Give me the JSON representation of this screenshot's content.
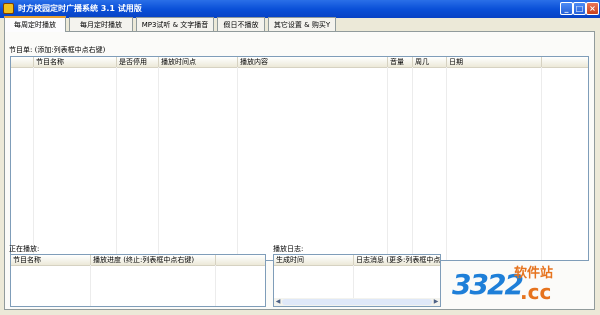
{
  "window": {
    "title": "时方校园定时广播系统 3.1 试用版",
    "buttons": {
      "minimize": "_",
      "maximize": "□",
      "close": "×"
    }
  },
  "tabs": [
    {
      "label": "每周定时播放",
      "active": true
    },
    {
      "label": "每月定时播放",
      "active": false
    },
    {
      "label": "MP3试听 & 文字播音",
      "active": false
    },
    {
      "label": "假日不播放",
      "active": false
    },
    {
      "label": "其它设置 & 购买Y",
      "active": false
    }
  ],
  "program_list": {
    "label": "节目单: (添加:列表框中点右键)",
    "columns": [
      "",
      "节目名称",
      "是否停用",
      "播放时间点",
      "播放内容",
      "音量",
      "周几",
      "日期"
    ]
  },
  "now_playing": {
    "label": "正在播放:",
    "columns": [
      "节目名称",
      "播放进度 (终止:列表框中点右键)"
    ]
  },
  "play_log": {
    "label": "播放日志:",
    "columns": [
      "生成时间",
      "日志消息 (更多:列表框中点右键)"
    ]
  },
  "watermark": {
    "number": "3322",
    "site_cn": "软件站",
    "domain": ".cc"
  }
}
